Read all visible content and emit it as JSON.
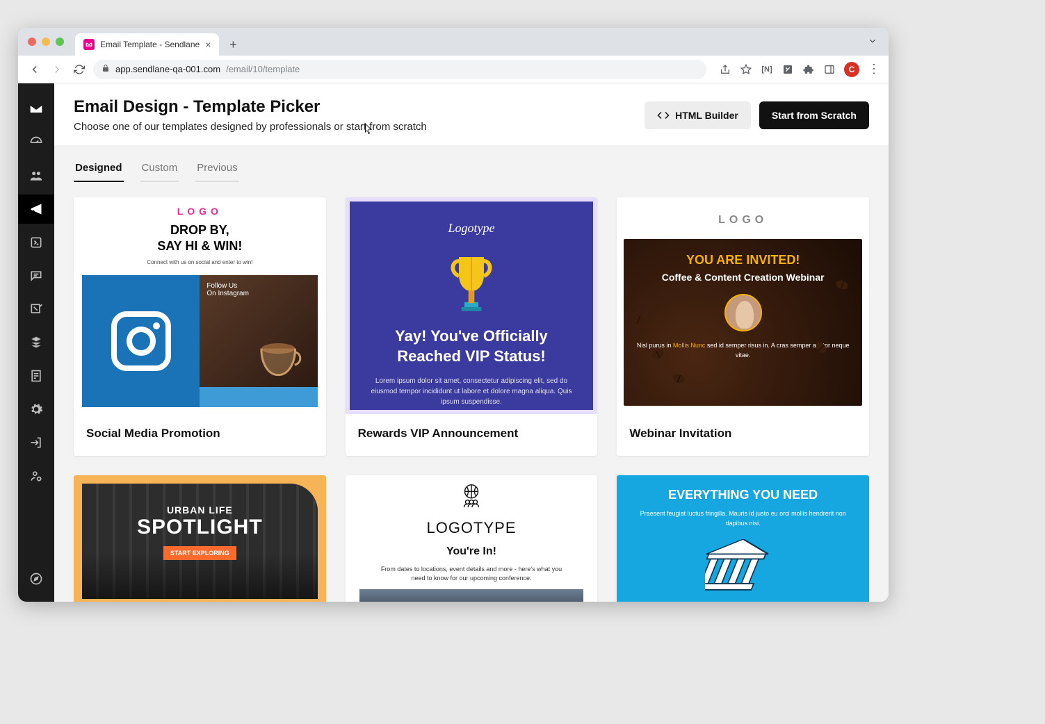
{
  "browser": {
    "tab_title": "Email Template - Sendlane",
    "url_host": "app.sendlane-qa-001.com",
    "url_path": "/email/10/template",
    "profile_initial": "C"
  },
  "header": {
    "title": "Email Design - Template Picker",
    "subtitle": "Choose one of our templates designed by professionals or start from scratch",
    "btn_html": "HTML Builder",
    "btn_scratch": "Start from Scratch"
  },
  "tabs": [
    "Designed",
    "Custom",
    "Previous"
  ],
  "active_tab": 0,
  "templates": [
    {
      "name": "Social Media Promotion",
      "preview": {
        "logo": "LOGO",
        "headline1": "DROP BY,",
        "headline2": "SAY HI & WIN!",
        "sub": "Connect with us on social and enter to win!",
        "follow1": "Follow Us",
        "follow2": "On Instagram"
      }
    },
    {
      "name": "Rewards VIP Announcement",
      "preview": {
        "logo": "Logotype",
        "headline": "Yay! You've Officially Reached VIP Status!",
        "body": "Lorem ipsum dolor sit amet, consectetur adipiscing elit, sed do eiusmod tempor incididunt ut labore et dolore magna aliqua. Quis ipsum suspendisse."
      }
    },
    {
      "name": "Webinar Invitation",
      "preview": {
        "logo": "LOGO",
        "headline": "YOU ARE INVITED!",
        "sub": "Coffee & Content Creation Webinar",
        "foot1": "Nisl purus in ",
        "foot_accent": "Mollis Nunc",
        "foot2": " sed id semper risus in. A cras semper auctor neque vitae."
      }
    },
    {
      "name": "",
      "preview": {
        "line1": "URBAN LIFE",
        "line2": "SPOTLIGHT",
        "cta": "START EXPLORING"
      }
    },
    {
      "name": "",
      "preview": {
        "logo": "LOGOTYPE",
        "head": "You're In!",
        "body": "From dates to locations, event details and more - here's what you need to know for our upcoming conference."
      }
    },
    {
      "name": "",
      "preview": {
        "head": "EVERYTHING YOU NEED",
        "body": "Praesent feugiat luctus fringilla. Mauris id justo eu orci mollis hendrerit non dapibus nisi."
      }
    }
  ]
}
